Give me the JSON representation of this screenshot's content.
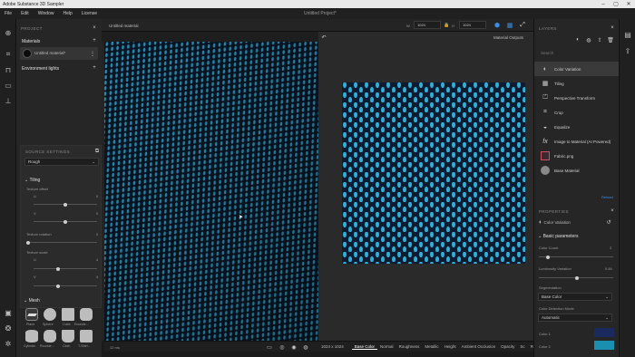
{
  "app": {
    "title": "Adobe Substance 3D Sampler",
    "project_title": "Untitled Project*"
  },
  "menu": [
    "File",
    "Edit",
    "Window",
    "Help",
    "License"
  ],
  "project": {
    "header": "PROJECT",
    "materials_label": "Materials",
    "material_name": "Untitled material*",
    "env_lights_label": "Environment lights"
  },
  "source": {
    "header": "SOURCE SETTINGS",
    "dropdown": "Rough",
    "tiling_label": "Tiling",
    "texture_offset": "Texture offset",
    "u": "U",
    "v": "V",
    "u_val": "0",
    "v_val": "0",
    "texture_rotation": "Texture rotation",
    "rotation_val": "0",
    "texture_scale": "Texture scale",
    "scale_u_val": "4",
    "scale_v_val": "4",
    "mesh_label": "Mesh",
    "meshes": [
      "Plane",
      "Sphere",
      "Cube",
      "Rounde...",
      "Cylinder",
      "Rounde...",
      "Cloth",
      "T-Shirt..."
    ]
  },
  "viewport": {
    "material_tab": "Untitled material",
    "width": "1024",
    "height": "1024",
    "output": "Material Outputs",
    "fps": "12 ms",
    "resolution": "1024 x 1024",
    "channels": [
      "Base Color",
      "Normal",
      "Roughness",
      "Metallic",
      "Height",
      "Ambient Occlusion",
      "Opacity",
      "Sc"
    ],
    "rgba": "RGBA: 8bpc"
  },
  "layers": {
    "header": "LAYERS",
    "search": "Search",
    "items": [
      {
        "label": "Color Variation",
        "icon": "palette-icon"
      },
      {
        "label": "Tiling",
        "icon": "grid-icon"
      },
      {
        "label": "Perspective Transform",
        "icon": "perspective-icon"
      },
      {
        "label": "Crop",
        "icon": "crop-icon"
      },
      {
        "label": "Equalize",
        "icon": "equalize-icon"
      },
      {
        "label": "Image to Material (AI Powered)",
        "icon": "fx-icon"
      },
      {
        "label": "Fabric.png",
        "icon": "image-icon"
      },
      {
        "label": "Base Material",
        "icon": "sphere-icon"
      }
    ],
    "reload": "Reload"
  },
  "properties": {
    "header": "PROPERTIES",
    "layer_name": "Color Variation",
    "basic_params": "Basic parameters",
    "color_count_label": "Color Count",
    "color_count_val": "3",
    "luminosity_label": "Luminosity Variation",
    "luminosity_val": "0.50",
    "segmentation_label": "Segmentation",
    "segmentation_val": "Base Color",
    "detection_label": "Color Detection Mode",
    "detection_val": "Automatic",
    "color1_label": "Color 1",
    "color2_label": "Color 2",
    "color1": "#1b2a5e",
    "color2": "#1b8fb0"
  },
  "colors": {
    "accent": "#3b8fe0",
    "fabric_dark": "#0d1c30",
    "fabric_light": "#2fa7d0"
  }
}
